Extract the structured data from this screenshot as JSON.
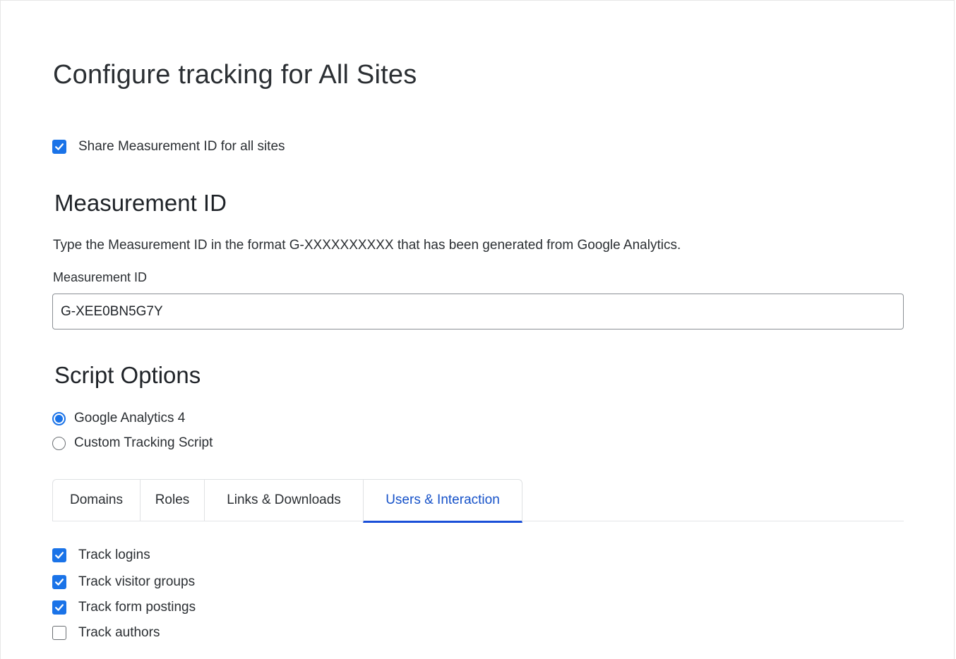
{
  "page": {
    "title": "Configure tracking for All Sites"
  },
  "share": {
    "label": "Share Measurement ID for all sites",
    "checked": true
  },
  "measurement": {
    "heading": "Measurement ID",
    "help": "Type the Measurement ID in the format G-XXXXXXXXXX that has been generated from Google Analytics.",
    "field_label": "Measurement ID",
    "value": "G-XEE0BN5G7Y"
  },
  "script_options": {
    "heading": "Script Options",
    "options": [
      {
        "label": "Google Analytics 4",
        "selected": true
      },
      {
        "label": "Custom Tracking Script",
        "selected": false
      }
    ]
  },
  "tabs": [
    {
      "label": "Domains",
      "active": false
    },
    {
      "label": "Roles",
      "active": false
    },
    {
      "label": "Links & Downloads",
      "active": false
    },
    {
      "label": "Users & Interaction",
      "active": true
    }
  ],
  "interaction": {
    "items": [
      {
        "label": "Track logins",
        "checked": true
      },
      {
        "label": "Track visitor groups",
        "checked": true
      },
      {
        "label": "Track form postings",
        "checked": true
      },
      {
        "label": "Track authors",
        "checked": false
      }
    ]
  },
  "colors": {
    "accent": "#1a73e8",
    "active_tab_text": "#1652c9",
    "active_tab_underline": "#1a4fd8"
  },
  "icons": {
    "checkbox_checked": "checkmark-icon",
    "radio_selected": "radio-dot-icon"
  }
}
